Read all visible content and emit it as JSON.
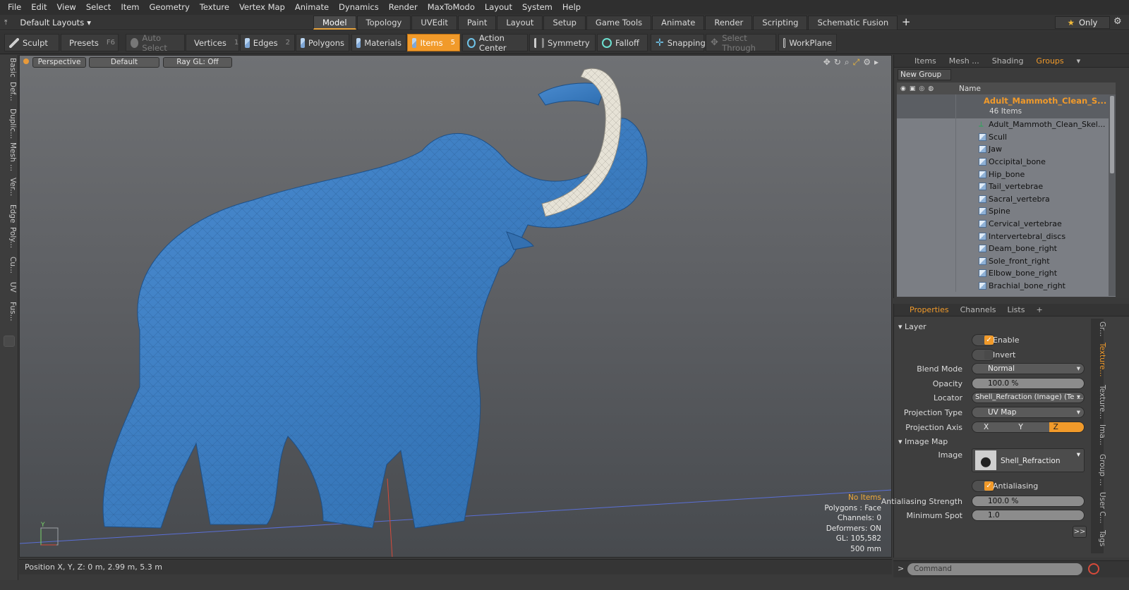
{
  "menubar": [
    "File",
    "Edit",
    "View",
    "Select",
    "Item",
    "Geometry",
    "Texture",
    "Vertex Map",
    "Animate",
    "Dynamics",
    "Render",
    "MaxToModo",
    "Layout",
    "System",
    "Help"
  ],
  "layout_selector": "Default Layouts",
  "mode_tabs": [
    "Model",
    "Topology",
    "UVEdit",
    "Paint",
    "Layout",
    "Setup",
    "Game Tools",
    "Animate",
    "Render",
    "Scripting",
    "Schematic Fusion"
  ],
  "active_mode_tab": "Model",
  "only_button": "Only",
  "toolbar": {
    "sculpt": "Sculpt",
    "presets": "Presets",
    "presets_key": "F6",
    "auto_select": "Auto Select",
    "vertices": "Vertices",
    "vertices_key": "1",
    "edges": "Edges",
    "edges_key": "2",
    "polygons": "Polygons",
    "materials": "Materials",
    "items": "Items",
    "items_key": "5",
    "action_center": "Action Center",
    "symmetry": "Symmetry",
    "falloff": "Falloff",
    "snapping": "Snapping",
    "select_through": "Select Through",
    "workplane": "WorkPlane"
  },
  "left_tabs": [
    "Basic",
    "Def...",
    "Duplic...",
    "Mesh ...",
    "Ver...",
    "Edge",
    "Poly...",
    "Cu...",
    "UV",
    "Fus..."
  ],
  "viewport": {
    "view": "Perspective",
    "shading": "Default",
    "raygl": "Ray GL: Off",
    "hud": {
      "no_items": "No Items",
      "polygons": "Polygons : Face",
      "channels": "Channels: 0",
      "deformers": "Deformers: ON",
      "gl": "GL: 105,582",
      "scale": "500 mm"
    }
  },
  "status_bar": "Position X, Y, Z:  0 m, 2.99 m, 5.3 m",
  "right_panel": {
    "tabs": [
      "Items",
      "Mesh ...",
      "Shading",
      "Groups"
    ],
    "active_tab": "Groups",
    "new_group": "New Group",
    "name_header": "Name",
    "group_title": "Adult_Mammoth_Clean_S...",
    "group_count": "46 Items",
    "items": [
      "Adult_Mammoth_Clean_Skel...",
      "Scull",
      "Jaw",
      "Occipital_bone",
      "Hip_bone",
      "Tail_vertebrae",
      "Sacral_vertebra",
      "Spine",
      "Cervical_vertebrae",
      "Intervertebral_discs",
      "Deam_bone_right",
      "Sole_front_right",
      "Elbow_bone_right",
      "Brachial_bone_right"
    ]
  },
  "properties": {
    "tabs": [
      "Properties",
      "Channels",
      "Lists"
    ],
    "layer_section": "Layer",
    "enable": "Enable",
    "invert": "Invert",
    "blend_mode_label": "Blend Mode",
    "blend_mode": "Normal",
    "opacity_label": "Opacity",
    "opacity": "100.0 %",
    "locator_label": "Locator",
    "locator": "Shell_Refraction (Image) (Te ...",
    "projection_type_label": "Projection Type",
    "projection_type": "UV Map",
    "projection_axis_label": "Projection Axis",
    "axis_x": "X",
    "axis_y": "Y",
    "axis_z": "Z",
    "image_map_section": "Image Map",
    "image_label": "Image",
    "image": "Shell_Refraction",
    "antialiasing": "Antialiasing",
    "aa_strength_label": "Antialiasing Strength",
    "aa_strength": "100.0 %",
    "min_spot_label": "Minimum Spot",
    "min_spot": "1.0",
    "more": ">>"
  },
  "side_tabs": [
    "Gr...",
    "Texture...",
    "Texture...",
    "Ima...",
    "Group ...",
    "User C...",
    "Tags"
  ],
  "command_placeholder": "Command",
  "colors": {
    "accent": "#f19a2a",
    "mesh": "#3f7fc0",
    "tusk": "#e6e2d6"
  }
}
